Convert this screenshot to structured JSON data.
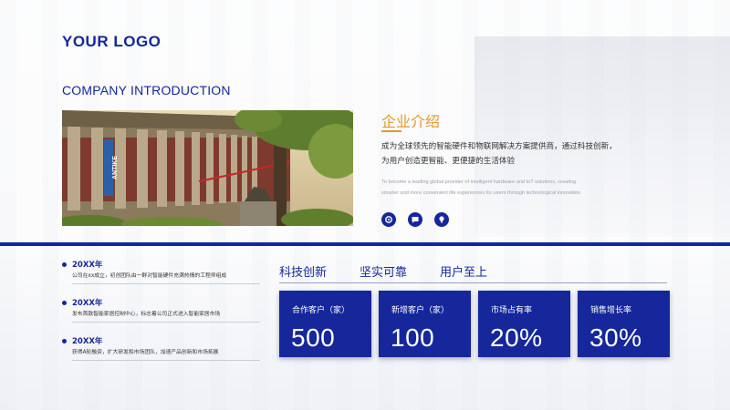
{
  "logo": "YOUR LOGO",
  "company_title": "COMPANY INTRODUCTION",
  "intro": {
    "title": "企业介绍",
    "paragraph_cn_1": "成为全球领先的智能硬件和物联网解决方案提供商，通过科技创新，",
    "paragraph_cn_2": "为用户创造更智能、更便捷的生活体验",
    "paragraph_en_1": "To become a leading global provider of intelligent hardware and IoT solutions, creating",
    "paragraph_en_2": "smarter and more convenient life experiences for users through technological innovation",
    "icons": [
      "settings-icon",
      "chat-icon",
      "lightbulb-icon"
    ]
  },
  "photo": {
    "banner_text": "ANTIKE"
  },
  "timeline": [
    {
      "year": "20XX年",
      "desc": "公司在xx成立，初创团队由一群对智能硬件充满热情的工程师组成"
    },
    {
      "year": "20XX年",
      "desc": "发布首款智能家居控制中心，标志着公司正式进入智能家居市场"
    },
    {
      "year": "20XX年",
      "desc": "获得A轮融资，扩大研发和市场团队，加速产品创新和市场拓展"
    }
  ],
  "values": [
    "科技创新",
    "坚实可靠",
    "用户至上"
  ],
  "stats": [
    {
      "label": "合作客户（家）",
      "value": "500"
    },
    {
      "label": "新增客户（家）",
      "value": "100"
    },
    {
      "label": "市场占有率",
      "value": "20%"
    },
    {
      "label": "销售增长率",
      "value": "30%"
    }
  ],
  "colors": {
    "primary": "#15279a",
    "accent": "#e39a24"
  }
}
